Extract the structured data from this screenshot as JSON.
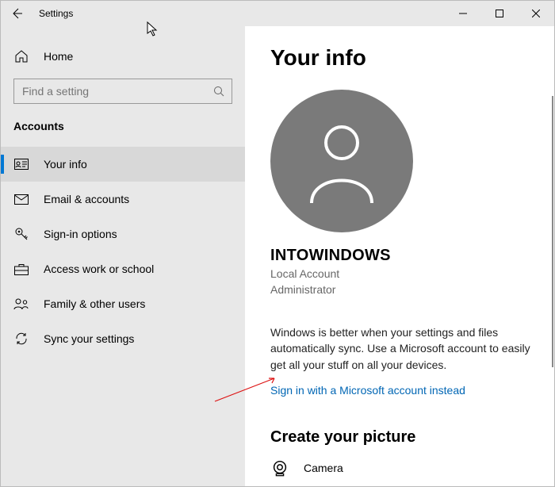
{
  "window": {
    "title": "Settings"
  },
  "sidebar": {
    "home": "Home",
    "search_placeholder": "Find a setting",
    "category": "Accounts",
    "items": [
      {
        "label": "Your info"
      },
      {
        "label": "Email & accounts"
      },
      {
        "label": "Sign-in options"
      },
      {
        "label": "Access work or school"
      },
      {
        "label": "Family & other users"
      },
      {
        "label": "Sync your settings"
      }
    ]
  },
  "main": {
    "heading": "Your info",
    "username": "INTOWINDOWS",
    "account_type": "Local Account",
    "role": "Administrator",
    "sync_blurb": "Windows is better when your settings and files automatically sync. Use a Microsoft account to easily get all your stuff on all your devices.",
    "signin_link": "Sign in with a Microsoft account instead",
    "picture_heading": "Create your picture",
    "camera_label": "Camera"
  }
}
